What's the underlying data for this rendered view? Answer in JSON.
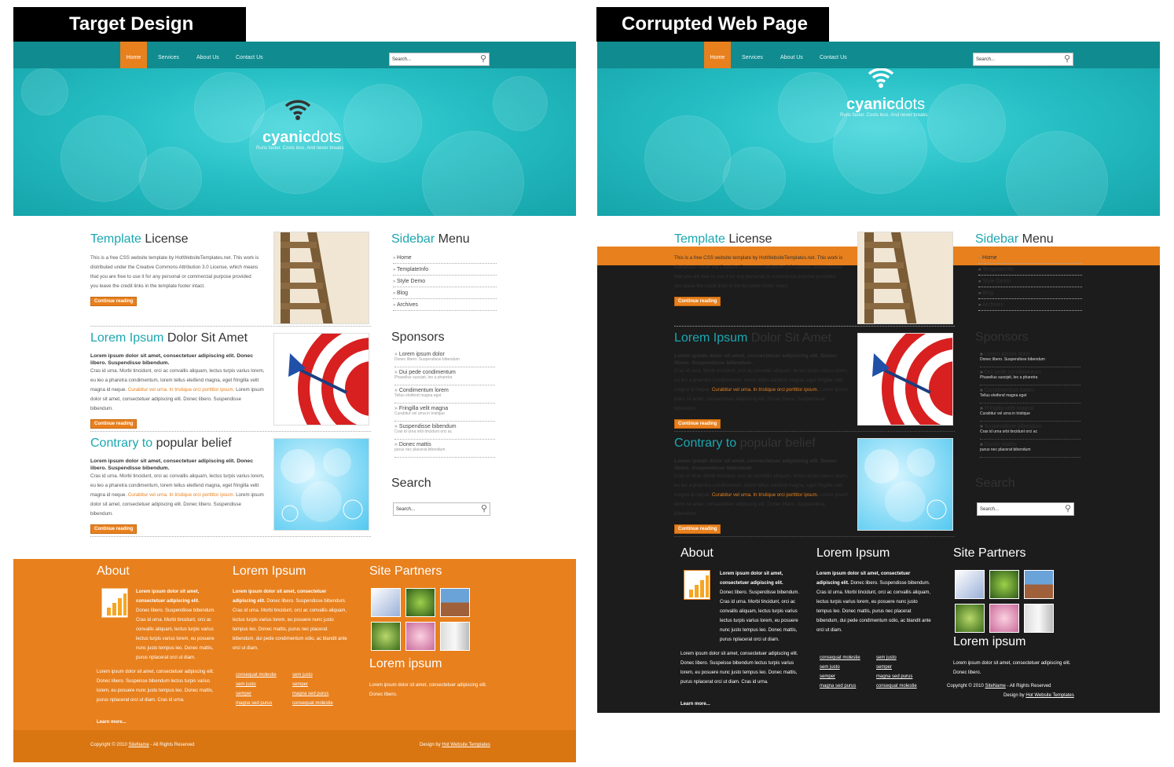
{
  "labels": {
    "target": "Target Design",
    "corrupted": "Corrupted Web Page"
  },
  "nav": {
    "items": [
      "Home",
      "Services",
      "About Us",
      "Contact Us"
    ],
    "search_placeholder": "Search..."
  },
  "logo": {
    "bold": "cyanic",
    "rest": "dots",
    "tagline": "Runs faster. Costs less. And never breaks"
  },
  "articles": [
    {
      "title_a": "Template",
      "title_b": "License",
      "intro": "",
      "text": "This is a free CSS website template by HotWebsiteTemplates.net. This work is distributed under the Creative Commons Attribution 3.0 License, which means that you are free to use it for any personal or commercial purpose provided you leave the credit links in the template footer intact.",
      "link": "",
      "after": "",
      "button": "Continue reading"
    },
    {
      "title_a": "Lorem Ipsum",
      "title_b": "Dolor Sit Amet",
      "intro": "Lorem ipsum dolor sit amet, consectetuer adipiscing elit. Donec libero. Suspendisse bibendum.",
      "text": "Cras id urna. Morbi tincidunt, orci ac convallis aliquam, lectus turpis varius lorem, eu leo a pharetra condimentum, lorem tellus eleifend magna, eget fringilla velit magna id neque.",
      "link": "Curabitur vel urna. In tristique orci porttitor ipsum.",
      "after": "Lorem ipsum dolor sit amet, consectetuer adipiscing elit. Donec libero. Suspendisse bibendum.",
      "button": "Continue reading"
    },
    {
      "title_a": "Contrary to",
      "title_b": "popular belief",
      "intro": "Lorem ipsum dolor sit amet, consectetuer adipiscing elit. Donec libero. Suspendisse bibendum.",
      "text": "Cras id urna. Morbi tincidunt, orci ac convallis aliquam, lectus turpis varius lorem, eu leo a pharetra condimentum, lorem tellus eleifend magna, eget fringilla velit magna id neque.",
      "link": "Curabitur vel urna. In tristique orci porttitor ipsum.",
      "after": "Lorem ipsum dolor sit amet, consectetuer adipiscing elit. Donec libero. Suspendisse bibendum.",
      "button": "Continue reading"
    }
  ],
  "sidebar": {
    "title_a": "Sidebar",
    "title_b": "Menu",
    "items": [
      "Home",
      "TemplateInfo",
      "Style Demo",
      "Blog",
      "Archives"
    ]
  },
  "sponsors": {
    "title": "Sponsors",
    "items": [
      {
        "name": "Lorem ipsum dolor",
        "sub": "Donec libero. Suspendisse bibendum"
      },
      {
        "name": "Dui pede condimentum",
        "sub": "Phasellus suscipit, leo a pharetra"
      },
      {
        "name": "Condimentum lorem",
        "sub": "Tellus eleifend magna eget"
      },
      {
        "name": "Fringilla velit magna",
        "sub": "Curabitur vel urna in tristique"
      },
      {
        "name": "Suspendisse bibendum",
        "sub": "Cras id urna orbi tincidunt orci ac"
      },
      {
        "name": "Donec mattis",
        "sub": "purus nec placerat bibendum"
      }
    ]
  },
  "search_section": {
    "title": "Search",
    "placeholder": "Search..."
  },
  "footer": {
    "about_title": "About",
    "about_bold": "Lorem ipsum dolor sit amet, consectetuer adipiscing elit.",
    "about_text": "Donec libero. Suspendisse bibendum. Cras id urna. Morbi tincidunt, orci ac convallis aliquam, lectus turpis varius lectus turpis varius lorem, eu posuere nunc justo tempus leo. Donec mattis, purus nplacerat orci ut diam.",
    "about_text2": "Lorem ipsum dolor sit amet, consectetuer adipiscing elit. Donec libero. Suspeisse bibendum lectus turpis varius lorem, eu posuere nunc justo tempus leo. Donec mattis, purus nplacerat orci ut diam. Cras id urna.",
    "learn_more": "Learn more...",
    "lorem_title": "Lorem Ipsum",
    "lorem_bold": "Lorem ipsum dolor sit amet, consectetuer adipiscing elit.",
    "lorem_text": "Donec libero. Suspendisse bibendum. Cras id urna. Morbi tincidunt, orci ac convallis aliquam, lectus turpis varius lorem, eu posuere nunc justo tempus leo. Donec mattis, purus nec placerat bibendum, dui pede condimentum odio, ac blandit ante orci ut diam.",
    "links_left": [
      "consequat molestie",
      "sem justo",
      "semper",
      "magna sed purus"
    ],
    "links_right": [
      "sem justo",
      "semper",
      "magna sed purus",
      "consequat molestie"
    ],
    "partners_title": "Site Partners",
    "lorem2_title": "Lorem ipsum",
    "lorem2_text": "Lorem ipsum dolor sit amet, consectetuer adipiscing elit. Donec libero.",
    "copyright": "Copyright © 2010",
    "sitename": "SiteName",
    "rights": "- All Rights Reserved",
    "design_by": "Design by",
    "designer": "Hot Website Templates"
  },
  "colors": {
    "accent": "#e8801d",
    "teal": "#1ba7b1",
    "dark": "#1c1c1c"
  }
}
